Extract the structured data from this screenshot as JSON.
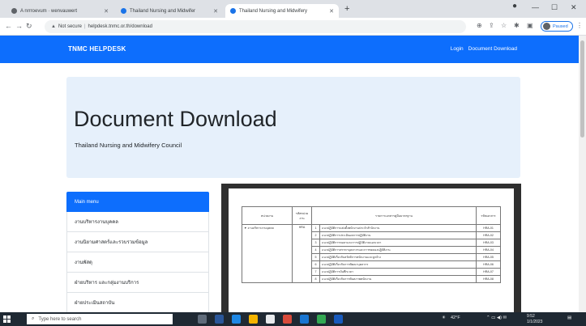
{
  "browser": {
    "tabs": [
      {
        "title": "A nrrroevum · wenvauwert",
        "active": false,
        "favicon_color": "#5f6368"
      },
      {
        "title": "Thailand Nursing and Midwifer",
        "active": false,
        "favicon_color": "#1a73e8"
      },
      {
        "title": "Thailand Nursing and Midwifery",
        "active": true,
        "favicon_color": "#1a73e8"
      }
    ],
    "new_tab": "+",
    "window_controls": {
      "minimize": "—",
      "maximize": "☐",
      "close": "✕"
    },
    "address": {
      "security": "Not secure",
      "url": "helpdesk.tnmc.or.th/download"
    },
    "profile_label": "Paused"
  },
  "site": {
    "brand": "TNMC HELPDESK",
    "nav_links": [
      "Login",
      "Document Download"
    ]
  },
  "hero": {
    "title": "Document Download",
    "subtitle": "Thailand Nursing and Midwifery Council"
  },
  "sidebar": {
    "items": [
      {
        "label": "Main menu",
        "active": true
      },
      {
        "label": "งานบริหารงานบุคคล",
        "active": false
      },
      {
        "label": "งานนิยามศาสตร์และรวบรวมข้อมูล",
        "active": false
      },
      {
        "label": "งานพัสดุ",
        "active": false
      },
      {
        "label": "ฝ่ายบริหาร และกลุ่มงานบริการ",
        "active": false
      },
      {
        "label": "ฝ่ายประเมินสถาบัน",
        "active": false
      }
    ]
  },
  "document": {
    "headers": [
      "หน่วยงาน",
      "รหัสหน่วยงาน",
      "รายการเอกสารคู่มือมาตรฐาน",
      "",
      "รหัสเอกสาร"
    ],
    "group_label": "▼ งานบริหารงานบุคคล",
    "group_code": "HRA",
    "rows": [
      {
        "no": "1",
        "desc": "แนวปฏิบัติการแต่งตั้งพนักงานประจำสำนักงาน",
        "code": "HRA-01"
      },
      {
        "no": "2",
        "desc": "แนวปฏิบัติการประเมินผลการปฏิบัติงาน",
        "code": "HRA-02"
      },
      {
        "no": "3",
        "desc": "แนวปฏิบัติการขอลาและการปฏิบัติงานนอกเวลา",
        "code": "HRA-03"
      },
      {
        "no": "4",
        "desc": "แนวปฏิบัติการสรรหาบุคลากรและการทดลองปฏิบัติงาน",
        "code": "HRA-04"
      },
      {
        "no": "5",
        "desc": "แนวปฏิบัติเกี่ยวกับสวัสดิการพนักงานและลูกจ้าง",
        "code": "HRA-05"
      },
      {
        "no": "6",
        "desc": "แนวปฏิบัติเกี่ยวกับการพัฒนาบุคลากร",
        "code": "HRA-06"
      },
      {
        "no": "7",
        "desc": "แนวปฏิบัติการบันทึกเวลา",
        "code": "HRA-07"
      },
      {
        "no": "8",
        "desc": "แนวปฏิบัติเกี่ยวกับการพ้นสภาพพนักงาน",
        "code": "HRA-08"
      }
    ]
  },
  "taskbar": {
    "search_placeholder": "Type here to search",
    "weather": "42°F",
    "time": "9:52",
    "date": "1/1/2023"
  },
  "colors": {
    "primary": "#0d6efd",
    "hero_bg": "#e6f0fb"
  }
}
